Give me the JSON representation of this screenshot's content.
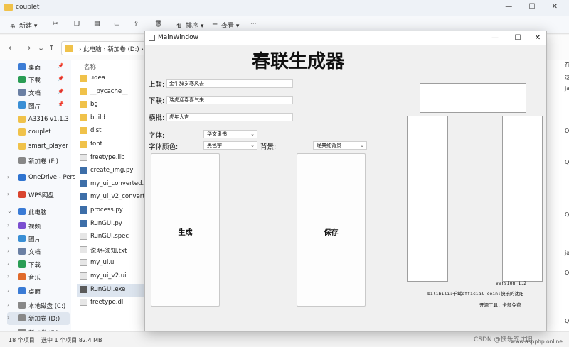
{
  "explorer": {
    "title": "couplet",
    "window_controls": "— ☐ ✕",
    "commands": {
      "new": "新建",
      "sort": "排序",
      "view": "查看",
      "more": "···"
    },
    "address": {
      "crumbs": "›  此电脑  ›  新加卷 (D:)  ›  c"
    },
    "sidebar": [
      {
        "label": "桌面",
        "pinned": true
      },
      {
        "label": "下载",
        "pinned": true
      },
      {
        "label": "文档",
        "pinned": true
      },
      {
        "label": "图片",
        "pinned": true
      },
      {
        "label": "A3316 v1.1.3"
      },
      {
        "label": "couplet"
      },
      {
        "label": "smart_player"
      },
      {
        "label": "新加卷 (F:)"
      },
      {
        "label": "OneDrive - Pers"
      },
      {
        "label": "WPS网盘"
      },
      {
        "label": "此电脑"
      },
      {
        "label": "视频"
      },
      {
        "label": "图片"
      },
      {
        "label": "文档"
      },
      {
        "label": "下载"
      },
      {
        "label": "音乐"
      },
      {
        "label": "桌面"
      },
      {
        "label": "本地磁盘 (C:)"
      },
      {
        "label": "新加卷 (D:)"
      },
      {
        "label": "新加卷 (F:)"
      }
    ],
    "file_header": "名称",
    "files": [
      {
        "name": ".idea",
        "type": "folder"
      },
      {
        "name": "__pycache__",
        "type": "folder"
      },
      {
        "name": "bg",
        "type": "folder"
      },
      {
        "name": "build",
        "type": "folder"
      },
      {
        "name": "dist",
        "type": "folder"
      },
      {
        "name": "font",
        "type": "folder"
      },
      {
        "name": "freetype.lib",
        "type": "file"
      },
      {
        "name": "create_img.py",
        "type": "py"
      },
      {
        "name": "my_ui_converted.py",
        "type": "py"
      },
      {
        "name": "my_ui_v2_converted.py",
        "type": "py"
      },
      {
        "name": "process.py",
        "type": "py"
      },
      {
        "name": "RunGUI.py",
        "type": "py"
      },
      {
        "name": "RunGUI.spec",
        "type": "file"
      },
      {
        "name": "说明-须知.txt",
        "type": "file"
      },
      {
        "name": "my_ui.ui",
        "type": "file"
      },
      {
        "name": "my_ui_v2.ui",
        "type": "file"
      },
      {
        "name": "RunGUI.exe",
        "type": "exe"
      },
      {
        "name": "freetype.dll",
        "type": "file"
      }
    ],
    "status": {
      "count": "18 个项目",
      "selected": "选中 1 个项目  82.4 MB"
    },
    "right_column": [
      "在",
      "这",
      "ja",
      "Q",
      "Q",
      "Q",
      "ja",
      "Q",
      "Q"
    ]
  },
  "mainwindow": {
    "title": "MainWindow",
    "controls": {
      "minimize": "—",
      "maximize": "☐",
      "close": "✕"
    },
    "app_title": "春联生成器",
    "upper_label": "上联:",
    "upper_value": "金牛辞岁寒风去",
    "lower_label": "下联:",
    "lower_value": "瑞虎迎春喜气来",
    "horizontal_label": "横批:",
    "horizontal_value": "虎年大吉",
    "font_label": "字体:",
    "font_value": "华文隶书",
    "color_label": "字体颜色:",
    "color_value": "黑色字",
    "bg_label": "背景:",
    "bg_value": "经典红背景",
    "generate_label": "生成",
    "save_label": "保存",
    "version": "version 1.2",
    "bilibili": "bilibili:千鹫official coin:快乐的沈阳",
    "open_source": "开源工具，全部免费"
  },
  "watermark": "CSDN @快乐的沈阳",
  "site_watermark": "www.aspphp.online",
  "colors": {
    "folder": "#f0c24a",
    "py": "#3d6ea8",
    "exe": "#5a5a5a",
    "selected": "#dde5ef"
  }
}
